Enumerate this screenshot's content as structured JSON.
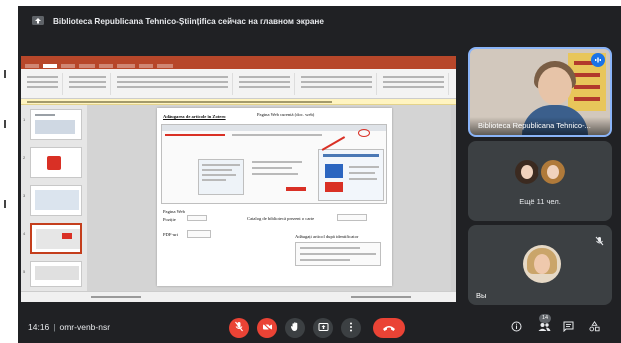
{
  "banner": {
    "text": "Biblioteca Republicana Tehnico-Științifica сейчас на главном экране"
  },
  "slide": {
    "title_left": "Adăugarea de articole în Zotero",
    "title_right": "Pagina Web curentă (doc. web)",
    "label_pagina_web": "Pagina Web",
    "label_pozitie": "Poziție",
    "label_pdf": "PDF-uri",
    "label_catalog": "Catalog de bibliotecă prezent o carte",
    "label_identifier": "Adăugați articol după identificator"
  },
  "tiles": {
    "speaker_name": "Biblioteca Republicana Tehnico-...",
    "others_label": "Ещё 11 чел.",
    "me_label": "Вы"
  },
  "bottom": {
    "time": "14:16",
    "separator": "|",
    "meeting_code": "omr-venb-nsr",
    "participants_badge": "14"
  },
  "colors": {
    "meet_bg": "#202124",
    "tile_bg": "#3c4043",
    "danger": "#ea4335",
    "accent": "#8ab4f8",
    "ppt_brand": "#b7472a"
  },
  "icons": {
    "banner": "present-to-all-icon",
    "mic": "mic-off-icon",
    "cam": "camera-off-icon",
    "hand": "raise-hand-icon",
    "present": "present-icon",
    "more": "more-vert-icon",
    "hangup": "hang-up-icon",
    "info": "info-icon",
    "people": "people-icon",
    "chat": "chat-icon",
    "activities": "activities-icon",
    "speaking": "speaking-indicator-icon",
    "muted": "mic-muted-icon"
  }
}
